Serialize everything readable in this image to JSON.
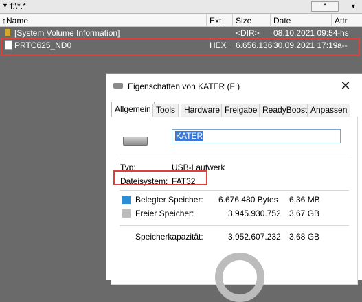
{
  "pathbar": {
    "path": "f:\\*.*",
    "filter": "*"
  },
  "columns": {
    "name": "↑Name",
    "ext": "Ext",
    "size": "Size",
    "date": "Date",
    "attr": "Attr"
  },
  "files": [
    {
      "name": "[System Volume Information]",
      "ext": "",
      "size": "<DIR>",
      "date": "08.10.2021 09:54",
      "attr": "--hs"
    },
    {
      "name": "PRTC625_ND0",
      "ext": "HEX",
      "size": "6.656.136",
      "date": "30.09.2021 17:19",
      "attr": "-a--"
    }
  ],
  "dialog": {
    "title": "Eigenschaften von KATER (F:)",
    "tabs": [
      "Allgemein",
      "Tools",
      "Hardware",
      "Freigabe",
      "ReadyBoost",
      "Anpassen"
    ],
    "volume_name": "KATER",
    "type_label": "Typ:",
    "type_value": "USB-Laufwerk",
    "fs_label": "Dateisystem:",
    "fs_value": "FAT32",
    "used_label": "Belegter Speicher:",
    "used_bytes": "6.676.480 Bytes",
    "used_size": "6,36 MB",
    "free_label": "Freier Speicher:",
    "free_bytes": "3.945.930.752",
    "free_size": "3,67 GB",
    "cap_label": "Speicherkapazität:",
    "cap_bytes": "3.952.607.232",
    "cap_size": "3,68 GB"
  },
  "colors": {
    "used": "#2b8fd6",
    "free": "#bcbcbc",
    "highlight": "#e0403a"
  }
}
